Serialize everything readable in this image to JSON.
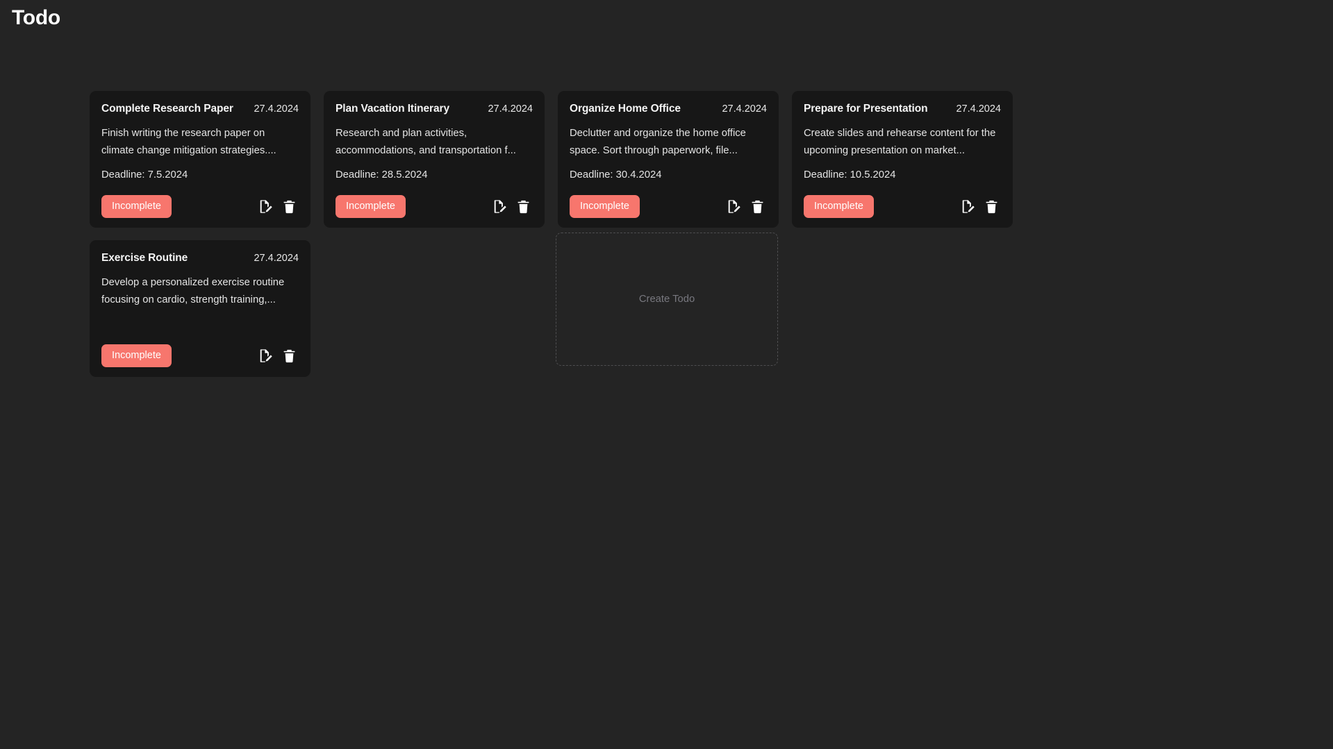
{
  "app": {
    "title": "Todo",
    "background_color": "#242424",
    "card_color": "#171717",
    "accent_color": "#f7766d"
  },
  "todos": [
    {
      "title": "Complete Research Paper",
      "date": "27.4.2024",
      "description": "Finish writing the research paper on climate change mitigation strategies....",
      "deadline": "Deadline: 7.5.2024",
      "status": "Incomplete",
      "edit_icon": "document-edit-icon",
      "delete_icon": "trash-icon"
    },
    {
      "title": "Plan Vacation Itinerary",
      "date": "27.4.2024",
      "description": "Research and plan activities, accommodations, and transportation f...",
      "deadline": "Deadline: 28.5.2024",
      "status": "Incomplete",
      "edit_icon": "document-edit-icon",
      "delete_icon": "trash-icon"
    },
    {
      "title": "Organize Home Office",
      "date": "27.4.2024",
      "description": "Declutter and organize the home office space. Sort through paperwork, file...",
      "deadline": "Deadline: 30.4.2024",
      "status": "Incomplete",
      "edit_icon": "document-edit-icon",
      "delete_icon": "trash-icon"
    },
    {
      "title": "Prepare for Presentation",
      "date": "27.4.2024",
      "description": "Create slides and rehearse content for the upcoming presentation on market...",
      "deadline": "Deadline: 10.5.2024",
      "status": "Incomplete",
      "edit_icon": "document-edit-icon",
      "delete_icon": "trash-icon"
    },
    {
      "title": "Exercise Routine",
      "date": "27.4.2024",
      "description": "Develop a personalized exercise routine focusing on cardio, strength training,...",
      "deadline": "",
      "status": "Incomplete",
      "edit_icon": "document-edit-icon",
      "delete_icon": "trash-icon"
    }
  ],
  "create_todo": {
    "label": "Create Todo"
  }
}
